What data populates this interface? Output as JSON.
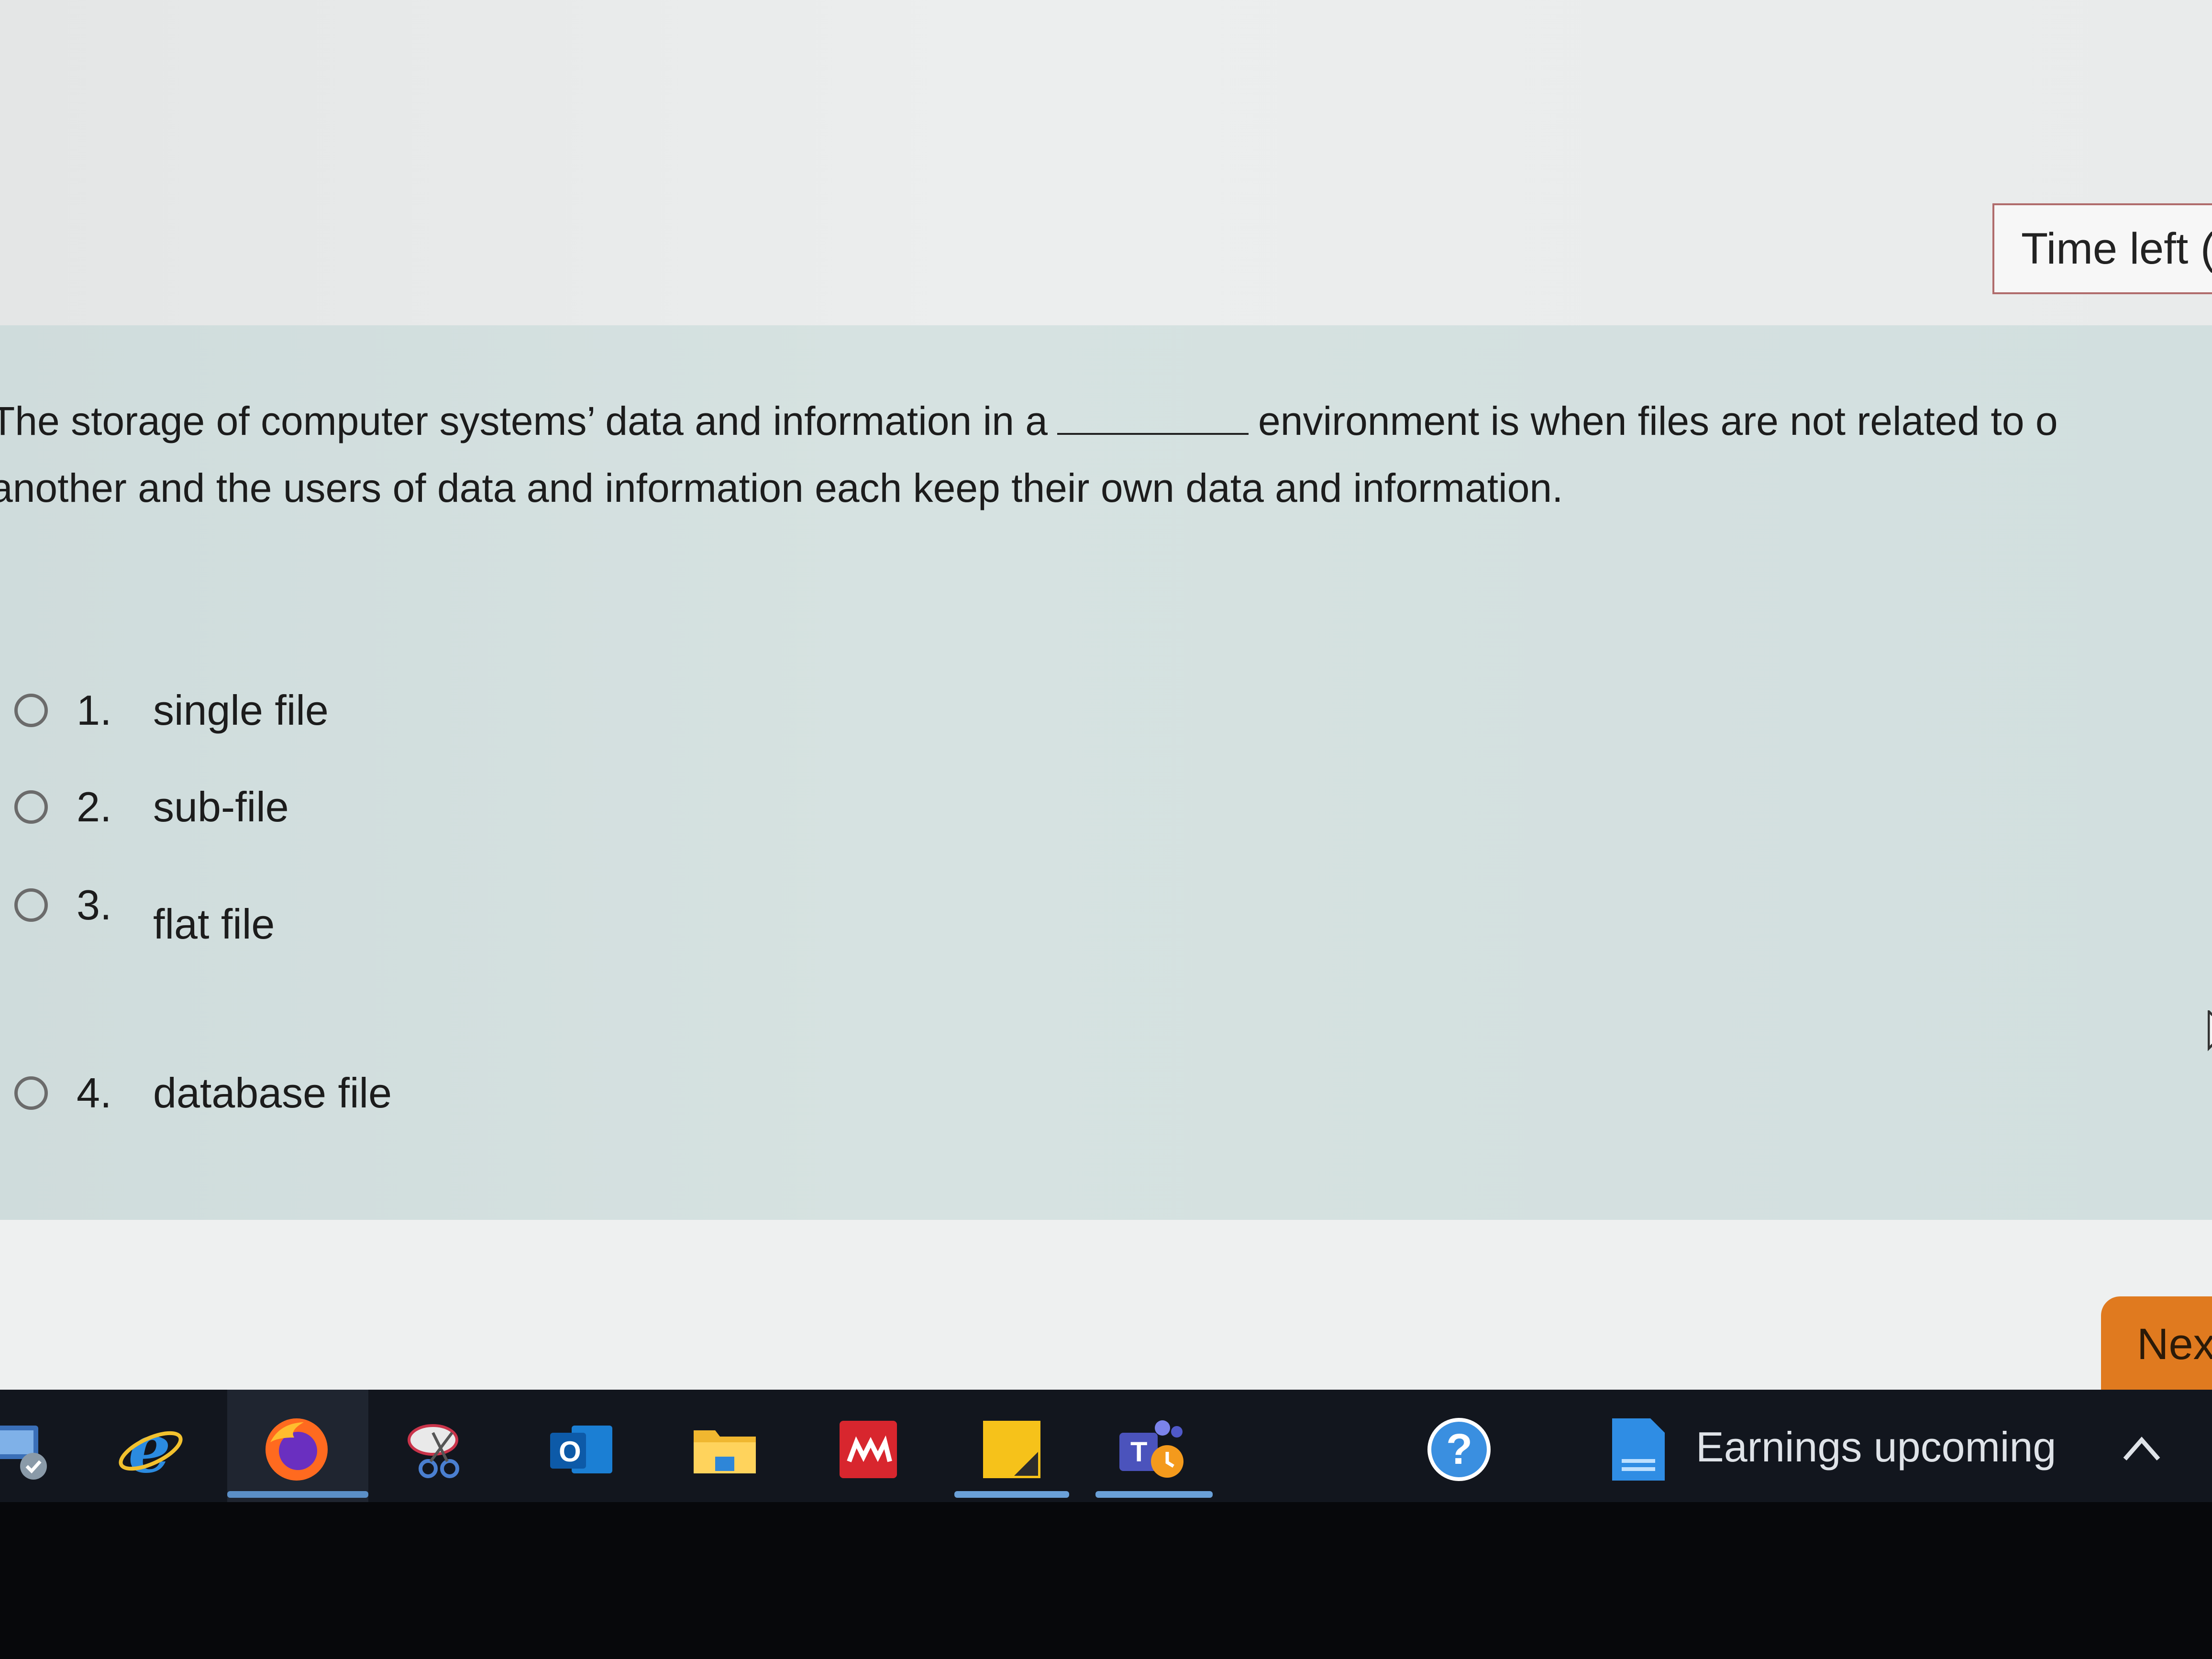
{
  "timer": {
    "label": "Time left ("
  },
  "question": {
    "text_before": "The storage of computer systems’ data and information in a",
    "text_after": "environment is when files are not related to o",
    "line2": "another and the users of data and information each keep their own data and information."
  },
  "options": [
    {
      "number": "1.",
      "label": "single file"
    },
    {
      "number": "2.",
      "label": "sub-file"
    },
    {
      "number": "3.",
      "label": "flat file"
    },
    {
      "number": "4.",
      "label": "database file"
    }
  ],
  "navigation": {
    "next_label": "Nex"
  },
  "taskbar": {
    "icons": [
      "network-icon",
      "internet-explorer-icon",
      "firefox-icon",
      "snipping-tool-icon",
      "outlook-icon",
      "file-explorer-icon",
      "red-app-icon",
      "sticky-notes-icon",
      "teams-icon",
      "help-icon",
      "weather-widget-icon"
    ],
    "news_text": "Earnings upcoming"
  },
  "colors": {
    "panel_bg": "#d3dfdf",
    "next_button": "#e07a1f",
    "timer_border": "#b06c6c",
    "taskbar_bg": "#12161e"
  }
}
